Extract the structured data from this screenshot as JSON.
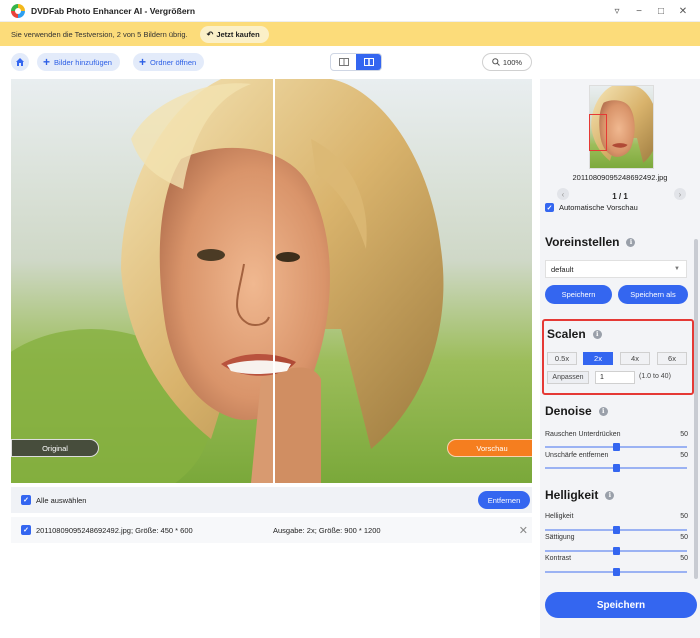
{
  "window": {
    "title": "DVDFab Photo Enhancer AI - Vergrößern",
    "controls": [
      "▿",
      "−",
      "□",
      "✕"
    ]
  },
  "banner": {
    "text": "Sie verwenden die Testversion, 2 von 5 Bildern übrig.",
    "buy_label": "Jetzt kaufen",
    "color": "#fcdc7a"
  },
  "toolbar": {
    "add_images_label": "Bilder hinzufügen",
    "open_folder_label": "Ordner öffnen",
    "zoom": "100%"
  },
  "preview": {
    "original_label": "Original",
    "preview_label": "Vorschau"
  },
  "list": {
    "select_all_label": "Alle auswählen",
    "remove_label": "Entfernen",
    "files": [
      {
        "name": "20110809095248692492.jpg; Größe: 450 * 600",
        "output": "Ausgabe: 2x; Größe: 900 * 1200"
      }
    ]
  },
  "panel": {
    "thumbnail_name": "20110809095248692492.jpg",
    "pager": "1 / 1",
    "auto_preview_label": "Automatische Vorschau",
    "presets": {
      "title": "Voreinstellen",
      "selected": "default",
      "save_label": "Speichern",
      "save_as_label": "Speichern als"
    },
    "scale": {
      "title": "Scalen",
      "options": [
        "0.5x",
        "2x",
        "4x",
        "6x"
      ],
      "selected": "2x",
      "fit_label": "Anpassen",
      "fit_value": "1",
      "fit_range": "(1.0 to 40)"
    },
    "denoise": {
      "title": "Denoise",
      "sliders": [
        {
          "label": "Rauschen Unterdrücken",
          "value": 50
        },
        {
          "label": "Unschärfe entfernen",
          "value": 50
        }
      ]
    },
    "brightness": {
      "title": "Helligkeit",
      "sliders": [
        {
          "label": "Helligkeit",
          "value": 50
        },
        {
          "label": "Sättigung",
          "value": 50
        },
        {
          "label": "Kontrast",
          "value": 50
        }
      ]
    },
    "save_main_label": "Speichern"
  },
  "colors": {
    "accent": "#3466f0",
    "preview_tag": "#f57e1f",
    "highlight": "#e53935"
  }
}
